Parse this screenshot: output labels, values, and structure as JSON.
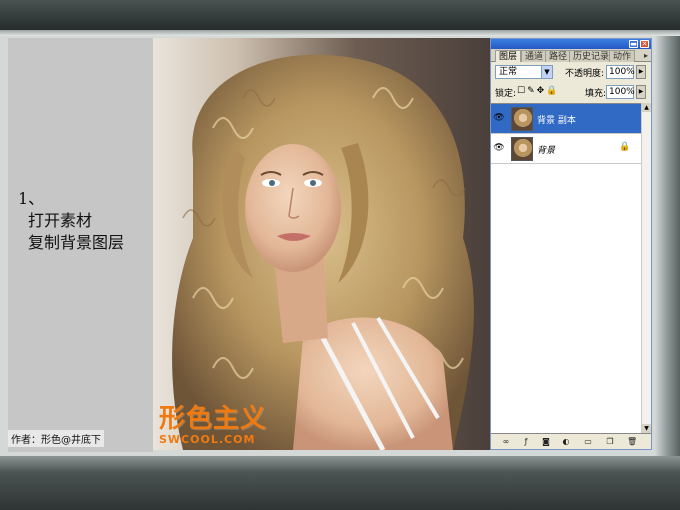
{
  "tutorial": {
    "step_number": "1、",
    "step_line1": "打开素材",
    "step_line2": "复制背景图层",
    "author": "作者：形色@井底下"
  },
  "watermark": {
    "logo_text": "形色主义",
    "site": "SWCOOL.COM"
  },
  "palette": {
    "tabs": [
      {
        "label": "图层",
        "active": true
      },
      {
        "label": "通道",
        "active": false
      },
      {
        "label": "路径",
        "active": false
      },
      {
        "label": "历史记录",
        "active": false
      },
      {
        "label": "动作",
        "active": false
      }
    ],
    "blend_mode": "正常",
    "opacity_label": "不透明度:",
    "opacity_value": "100%",
    "lock_label": "锁定:",
    "fill_label": "填充:",
    "fill_value": "100%",
    "layers": [
      {
        "name": "背景 副本",
        "selected": true,
        "locked": false
      },
      {
        "name": "背景",
        "selected": false,
        "locked": true
      }
    ]
  },
  "colors": {
    "selection": "#316ac5",
    "watermark_orange": "#f07a12",
    "titlebar_blue": "#2458c4"
  }
}
